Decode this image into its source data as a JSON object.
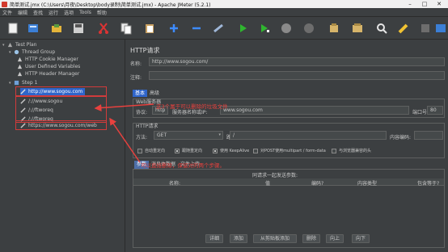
{
  "window": {
    "title": "简单测试.jmx (C:\\Users\\月夜\\Desktop\\body录制\\简单测试.jmx) - Apache JMeter (5.2.1)"
  },
  "menu": [
    "文件",
    "编辑",
    "查找",
    "运行",
    "选项",
    "Tools",
    "帮助"
  ],
  "tree": {
    "items": [
      {
        "label": "Test Plan",
        "icon": "test-plan-icon",
        "expander": "▾"
      },
      {
        "label": "Thread Group",
        "icon": "thread-group-icon",
        "expander": "▾"
      },
      {
        "label": "HTTP Cookie Manager",
        "icon": "config-icon",
        "expander": ""
      },
      {
        "label": "User Defined Variables",
        "icon": "config-icon",
        "expander": ""
      },
      {
        "label": "HTTP Header Manager",
        "icon": "config-icon",
        "expander": ""
      },
      {
        "label": "Step 1",
        "icon": "controller-icon",
        "expander": "▾"
      },
      {
        "label": "http://www.sogou.com",
        "icon": "sampler-icon",
        "expander": ""
      },
      {
        "label": "/://www.sogou",
        "icon": "sampler-icon",
        "expander": ""
      },
      {
        "label": "/://ftworeq",
        "icon": "sampler-icon",
        "expander": ""
      },
      {
        "label": "/://ftworeq",
        "icon": "sampler-icon",
        "expander": ""
      },
      {
        "label": "https://www.sogou.com/web",
        "icon": "sampler-icon",
        "expander": ""
      }
    ]
  },
  "sampler": {
    "header": "HTTP请求",
    "name_label": "名称:",
    "name_value": "http://www.sogou.com/",
    "comment_label": "注释:",
    "tabs": [
      "基本",
      "高级"
    ],
    "web_server_title": "Web服务器",
    "protocol_label": "协议:",
    "protocol_value": "http",
    "server_label": "服务器名称或IP:",
    "server_value": "www.sogou.com",
    "port_label": "端口号:",
    "port_value": "80",
    "http_request_title": "HTTP请求",
    "method_label": "方法:",
    "method_value": "GET",
    "path_label": "路径:",
    "path_value": "/",
    "encoding_label": "内容编码:",
    "checkboxes": [
      {
        "label": "自动重定向",
        "checked": false
      },
      {
        "label": "跟随重定向",
        "checked": true
      },
      {
        "label": "使用 KeepAlive",
        "checked": true
      },
      {
        "label": "对POST使用multipart / form-data",
        "checked": false
      },
      {
        "label": "与浏览器兼容的头",
        "checked": false
      }
    ],
    "params_tabs": [
      "参数",
      "消息体数据",
      "文件上传"
    ],
    "params_table_title": "同请求一起发送参数:",
    "columns": [
      "名称:",
      "值",
      "编码?",
      "内容类型",
      "包含等于?"
    ],
    "buttons": [
      "详细",
      "添加",
      "从剪贴板添加",
      "删除",
      "向上",
      "向下"
    ]
  },
  "annotations": {
    "text1": "这3个属于可以删除的垃圾文件",
    "text2": "可以直接删除，保留对的两个步骤。"
  },
  "colors": {
    "background": "#3c3f41",
    "selection": "#2f65ca",
    "annotation": "#e8413e"
  }
}
